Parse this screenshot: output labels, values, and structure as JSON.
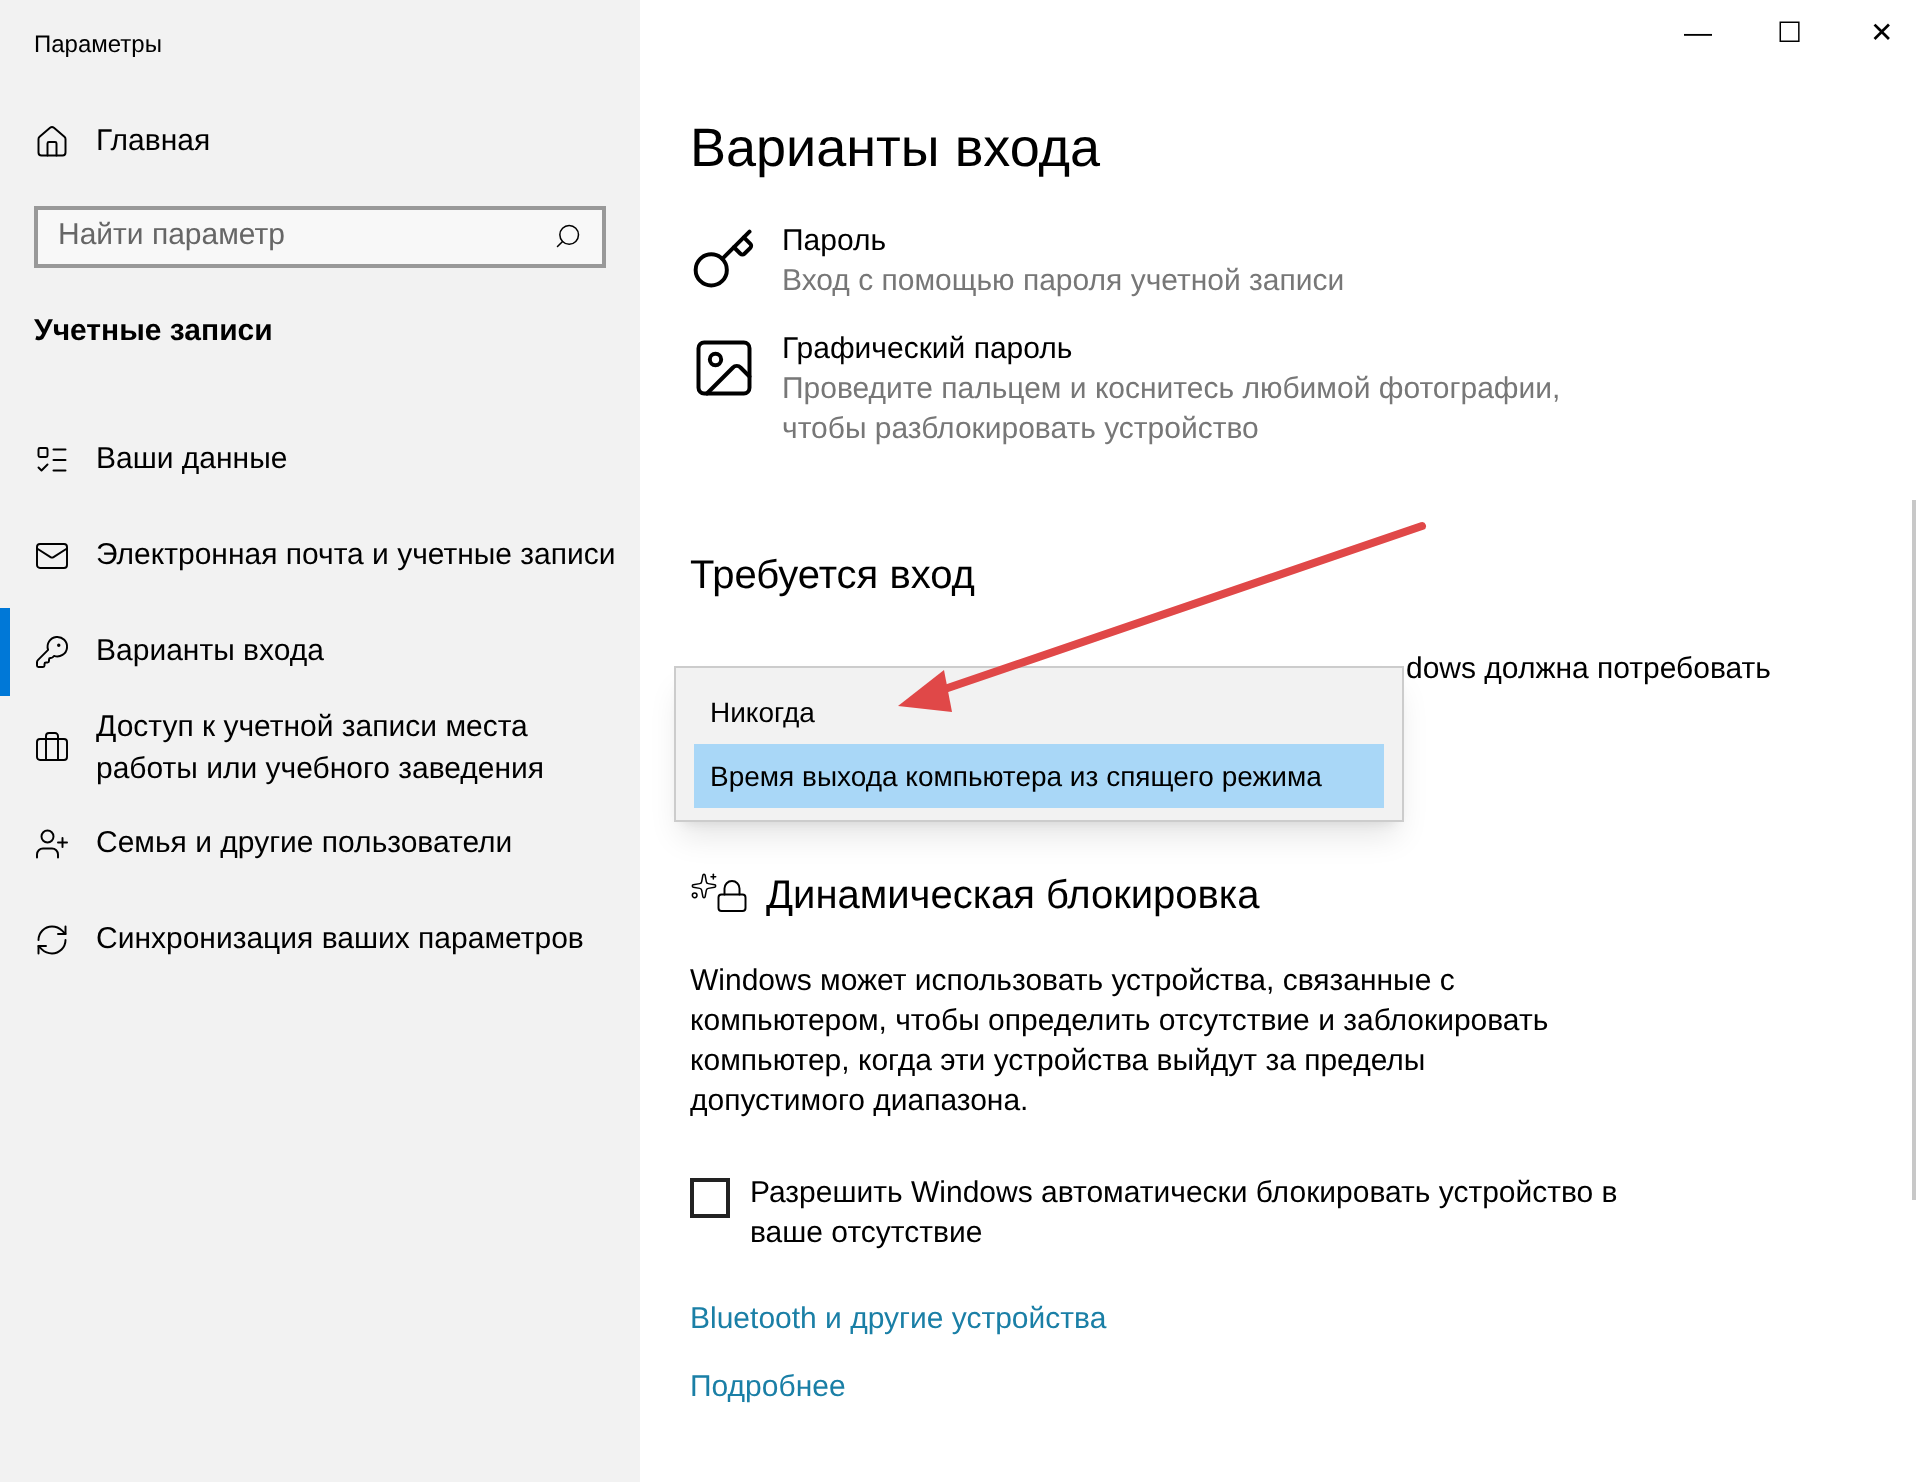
{
  "window": {
    "title": "Параметры",
    "controls": [
      "—",
      "☐",
      "✕"
    ]
  },
  "sidebar": {
    "home": "Главная",
    "search": {
      "placeholder": "Найти параметр"
    },
    "section": "Учетные записи",
    "items": [
      {
        "label": "Ваши данные",
        "selected": false
      },
      {
        "label": "Электронная почта и учетные записи",
        "selected": false
      },
      {
        "label": "Варианты входа",
        "selected": true
      },
      {
        "label": "Доступ к учетной записи места работы или учебного заведения",
        "selected": false
      },
      {
        "label": "Семья и другие пользователи",
        "selected": false
      },
      {
        "label": "Синхронизация ваших параметров",
        "selected": false
      }
    ]
  },
  "page": {
    "title": "Варианты входа",
    "options": [
      {
        "title": "Пароль",
        "description": "Вход с помощью пароля учетной записи"
      },
      {
        "title": "Графический пароль",
        "description": "Проведите пальцем и коснитесь любимой фотографии, чтобы разблокировать устройство"
      }
    ],
    "require_signin": {
      "heading": "Требуется вход",
      "text_fragment": "dows должна потребовать",
      "dropdown": [
        {
          "label": "Никогда",
          "selected": false
        },
        {
          "label": "Время выхода компьютера из спящего режима",
          "selected": true
        }
      ]
    },
    "dynamic_lock": {
      "heading": "Динамическая блокировка",
      "description": "Windows может использовать устройства, связанные с компьютером, чтобы определить отсутствие и заблокировать компьютер, когда эти устройства выйдут за пределы допустимого диапазона.",
      "checkbox": {
        "label": "Разрешить Windows автоматически блокировать устройство в ваше отсутствие",
        "checked": false
      }
    },
    "links": [
      "Bluetooth и другие устройства",
      "Подробнее"
    ]
  }
}
